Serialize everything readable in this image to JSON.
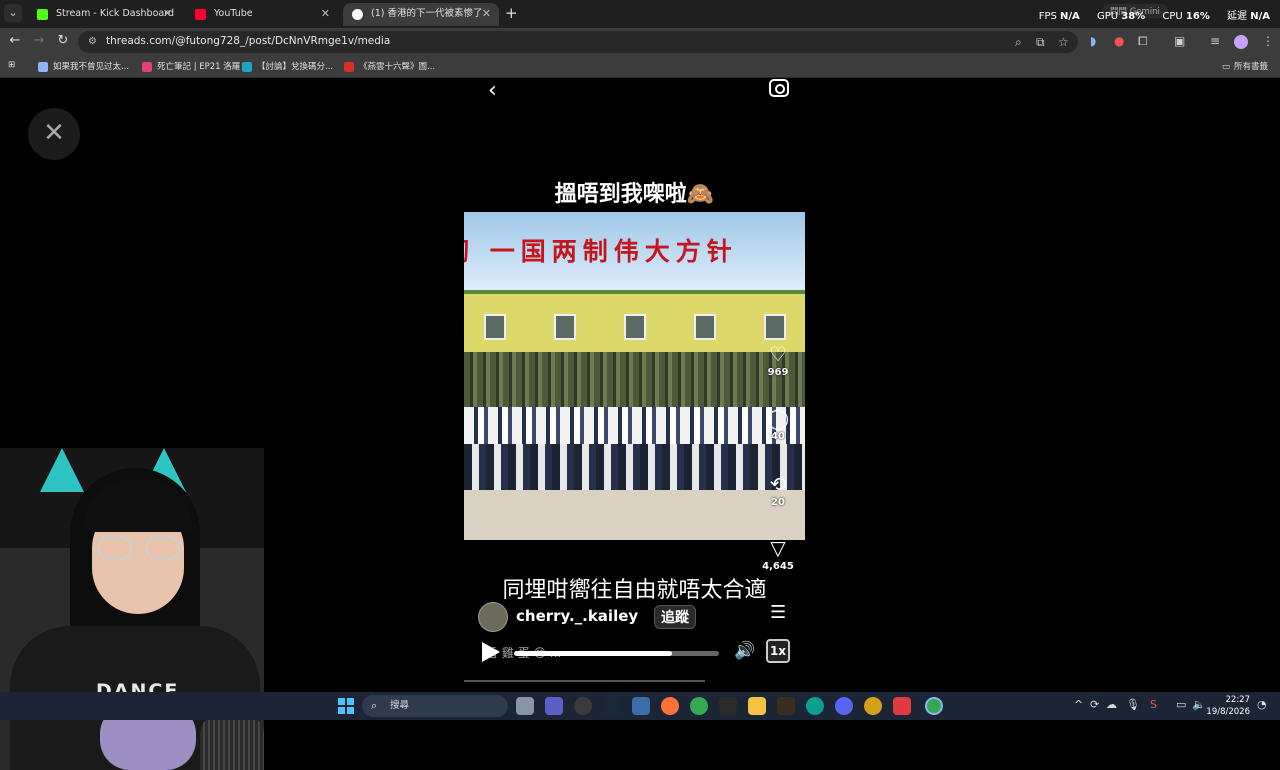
{
  "browser": {
    "tabs": [
      {
        "title": "Stream - Kick Dashboard",
        "favicon": "kick-icon",
        "color": "#53fc18"
      },
      {
        "title": "YouTube",
        "favicon": "youtube-icon",
        "color": "#ff0033"
      },
      {
        "title": "(1) 香港的下一代被素惨了",
        "favicon": "threads-icon",
        "color": "#ffffff",
        "active": true
      }
    ],
    "new_tab": "+",
    "stats": {
      "fps_label": "FPS",
      "fps": "N/A",
      "gpu_label": "GPU",
      "gpu": "38%",
      "cpu_label": "CPU",
      "cpu": "16%",
      "latency_label": "延遲",
      "latency": "N/A"
    },
    "gemini": "問問 Gemini",
    "url": "threads.com/@futong728_/post/DcNnVRmge1v/media",
    "bookmarks": [
      {
        "label": "如果我不曾见过太...",
        "color": "#8ab4f8"
      },
      {
        "label": "死亡筆記 | EP21 洛羅",
        "color": "#e2407a"
      },
      {
        "label": "【討論】兌換碼分...",
        "color": "#1ea4c9"
      },
      {
        "label": "《燕雲十六聲》圖...",
        "color": "#d93025"
      }
    ],
    "all_bookmarks": "所有書籤"
  },
  "post": {
    "caption_top": "搵唔到我㗎啦🙈",
    "banner": "彻 一国两制伟大方针",
    "likes": "969",
    "comments": "40",
    "reposts": "20",
    "shares": "4,645",
    "subtitle": "同埋咁嚮往自由就唔太合適",
    "username": "cherry._.kailey",
    "follow_label": "追蹤",
    "music": "香 雞 蛋 😊 ...",
    "progress": 0.77,
    "speed": "1x"
  },
  "webcam": {
    "shirt_text": "DANCE",
    "ear_color": "#2ec4c4"
  },
  "taskbar": {
    "search_placeholder": "搜尋",
    "time": "22:27",
    "date": "19/8/2026"
  }
}
